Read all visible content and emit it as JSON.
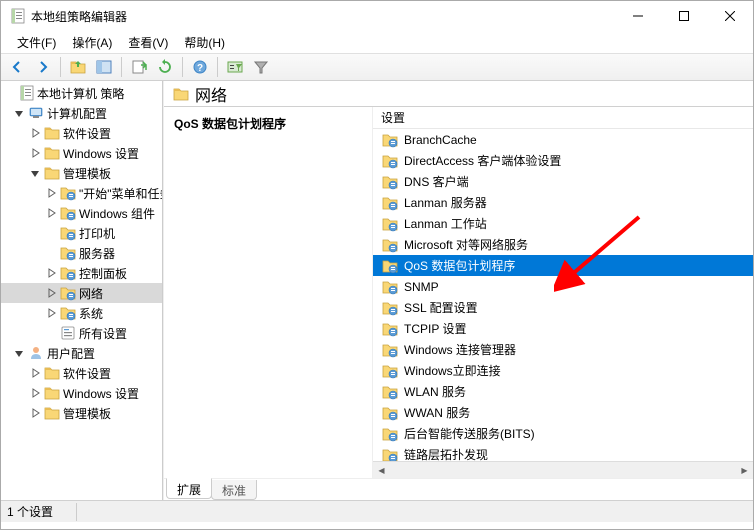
{
  "window": {
    "title": "本地组策略编辑器"
  },
  "menus": [
    "文件(F)",
    "操作(A)",
    "查看(V)",
    "帮助(H)"
  ],
  "tree": {
    "root_label": "本地计算机 策略",
    "c1": "计算机配置",
    "c1_1": "软件设置",
    "c1_2": "Windows 设置",
    "c1_3": "管理模板",
    "c1_3_1": "\"开始\"菜单和任务栏",
    "c1_3_2": "Windows 组件",
    "c1_3_3": "打印机",
    "c1_3_4": "服务器",
    "c1_3_5": "控制面板",
    "c1_3_6": "网络",
    "c1_3_7": "系统",
    "c1_3_8": "所有设置",
    "c2": "用户配置",
    "c2_1": "软件设置",
    "c2_2": "Windows 设置",
    "c2_3": "管理模板"
  },
  "content": {
    "header": "网络",
    "left_title": "QoS 数据包计划程序",
    "column_header": "设置",
    "items": [
      "BranchCache",
      "DirectAccess 客户端体验设置",
      "DNS 客户端",
      "Lanman 服务器",
      "Lanman 工作站",
      "Microsoft 对等网络服务",
      "QoS 数据包计划程序",
      "SNMP",
      "SSL 配置设置",
      "TCPIP 设置",
      "Windows 连接管理器",
      "Windows立即连接",
      "WLAN 服务",
      "WWAN 服务",
      "后台智能传送服务(BITS)",
      "链路层拓扑发现"
    ],
    "selected_index": 6
  },
  "tabs": {
    "t0": "扩展",
    "t1": "标准"
  },
  "status": "1 个设置"
}
